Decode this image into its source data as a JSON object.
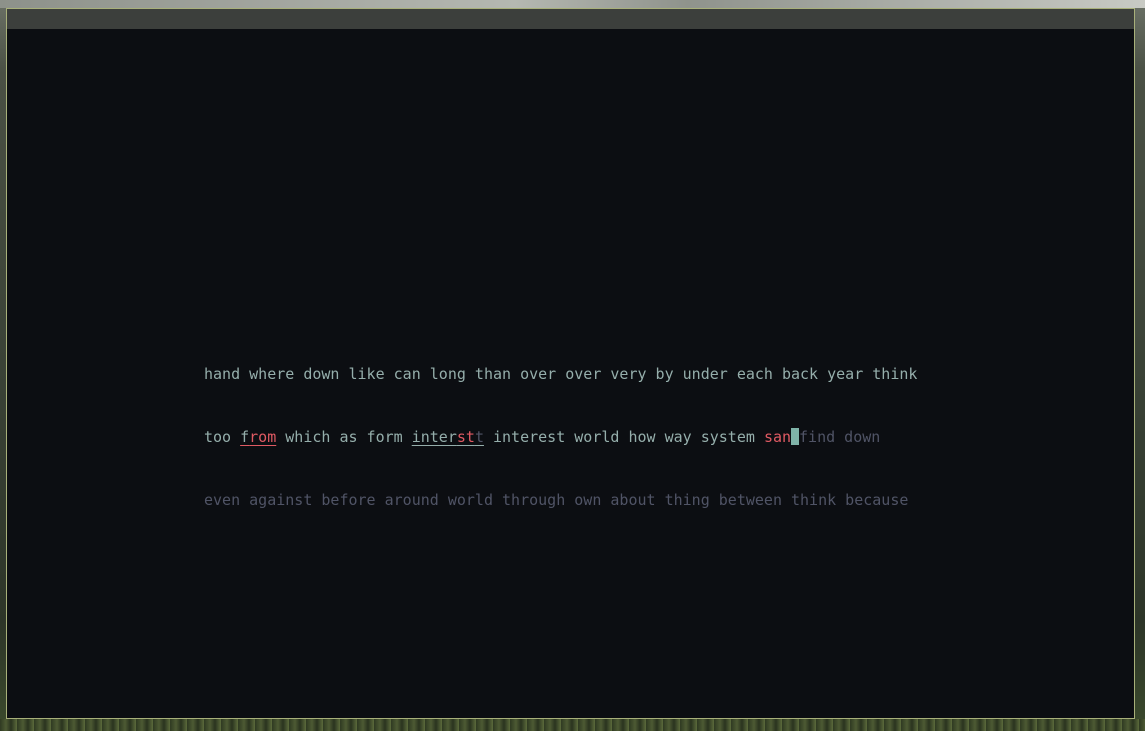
{
  "typing_test": {
    "line1": "hand where down like can long than over over very by under each back year think",
    "line2": {
      "w1": "too ",
      "from_f": "f",
      "from_rest": "rom",
      "w3": " which as form ",
      "inter_ok": "inter",
      "inter_err": "st",
      "inter_missing": "t",
      "w5": " interest world how way system ",
      "san": "san",
      "rest": "find down"
    },
    "line3": "even against before around world through own about thing between think because"
  },
  "colors": {
    "background": "#0c0e12",
    "text_typed": "#95aeab",
    "text_untyped": "#505466",
    "error": "#e05a63",
    "caret": "#7fb3a8",
    "window_border": "#a8b07a"
  }
}
